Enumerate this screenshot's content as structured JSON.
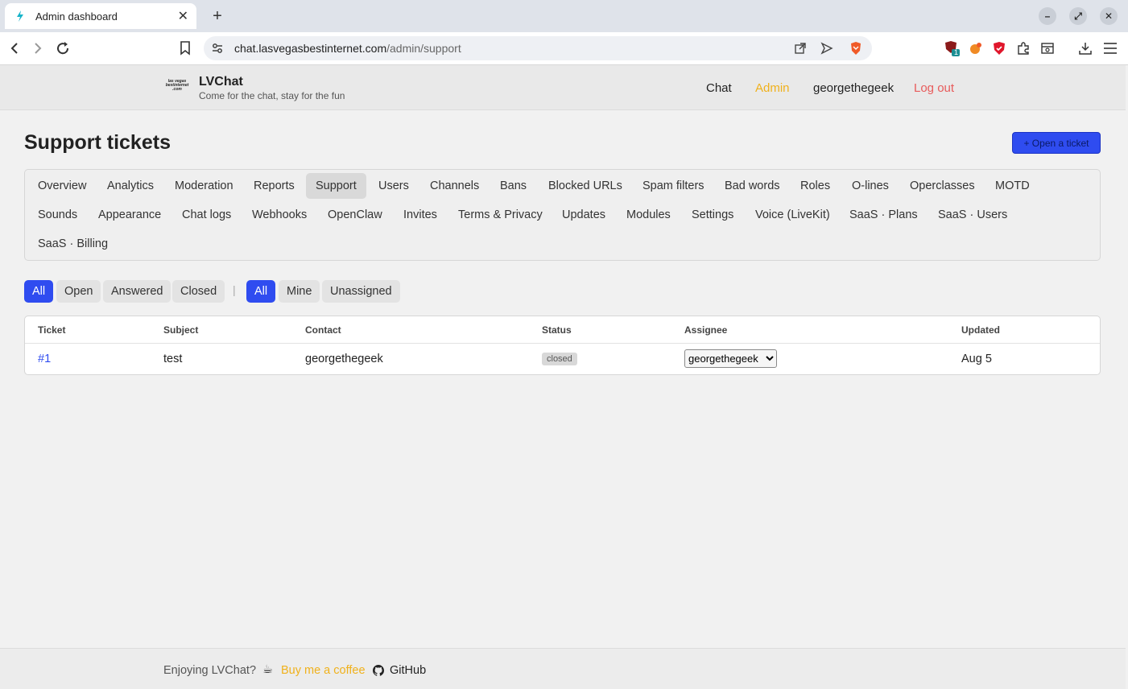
{
  "browser": {
    "tab_title": "Admin dashboard",
    "url_host": "chat.lasvegasbestinternet.com",
    "url_path": "/admin/support",
    "extension_badge": "1"
  },
  "header": {
    "logo_text": "las vegas best internet .com",
    "brand": "LVChat",
    "tagline": "Come for the chat, stay for the fun",
    "nav": {
      "chat": "Chat",
      "admin": "Admin",
      "user": "georgethegeek",
      "logout": "Log out"
    },
    "colors": {
      "admin": "#f0b11b",
      "logout": "#e85b5b"
    }
  },
  "page": {
    "title": "Support tickets",
    "open_ticket": "+ Open a ticket"
  },
  "admin_nav": {
    "items": [
      "Overview",
      "Analytics",
      "Moderation",
      "Reports",
      "Support",
      "Users",
      "Channels",
      "Bans",
      "Blocked URLs",
      "Spam filters",
      "Bad words",
      "Roles",
      "O-lines",
      "Operclasses",
      "MOTD",
      "Sounds",
      "Appearance",
      "Chat logs",
      "Webhooks",
      "OpenClaw",
      "Invites",
      "Terms & Privacy",
      "Updates",
      "Modules",
      "Settings",
      "Voice (LiveKit)",
      "SaaS · Plans",
      "SaaS · Users",
      "SaaS · Billing"
    ],
    "active": "Support"
  },
  "filters": {
    "status": [
      "All",
      "Open",
      "Answered",
      "Closed"
    ],
    "assignment": [
      "All",
      "Mine",
      "Unassigned"
    ],
    "separator": "|"
  },
  "table": {
    "headers": [
      "Ticket",
      "Subject",
      "Contact",
      "Status",
      "Assignee",
      "Updated"
    ],
    "rows": [
      {
        "ticket": "#1",
        "subject": "test",
        "contact": "georgethegeek",
        "status": "closed",
        "assignee": "georgethegeek",
        "updated": "Aug 5"
      }
    ]
  },
  "footer": {
    "enjoying": "Enjoying LVChat?",
    "coffee": "Buy me a coffee",
    "github": "GitHub"
  },
  "colors": {
    "accent": "#2f4cf0",
    "coffee": "#f0b11b"
  }
}
